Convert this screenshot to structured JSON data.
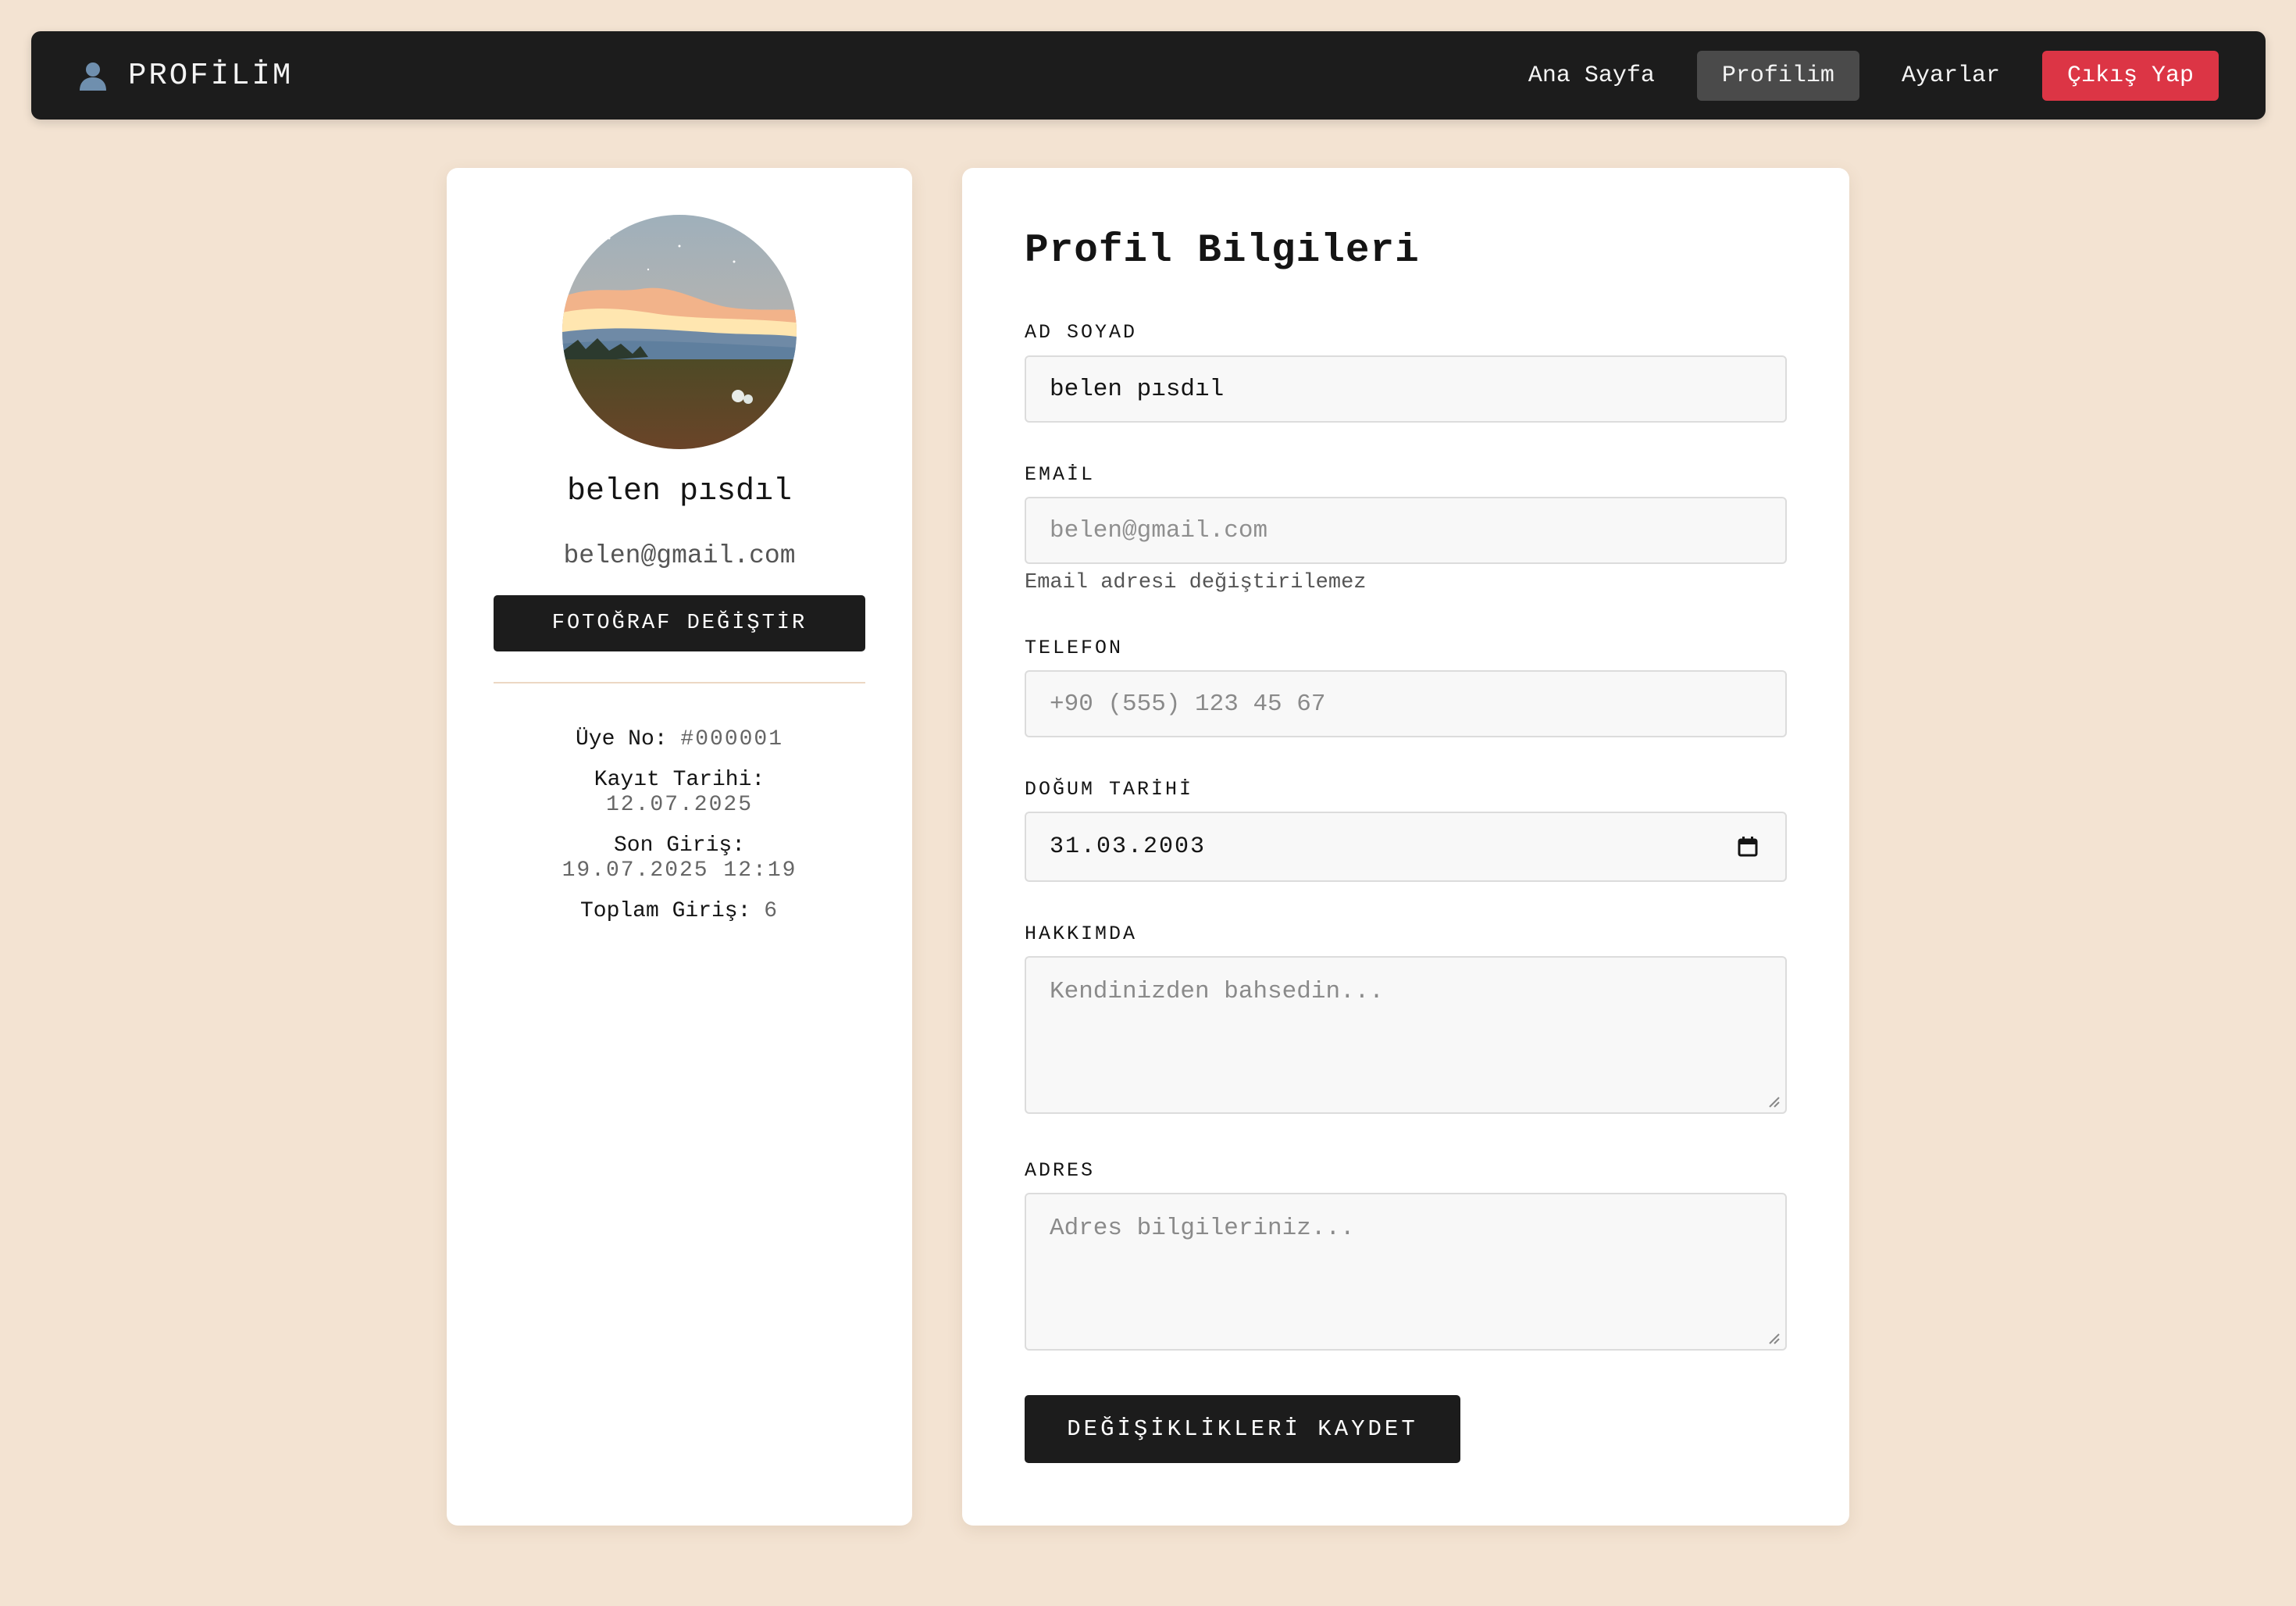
{
  "navbar": {
    "brand_icon": "user-icon",
    "brand": "PROFİLİM",
    "links": [
      "Ana Sayfa",
      "Profilim",
      "Ayarlar"
    ],
    "logout": "Çıkış Yap",
    "logout_color": "#dc3545"
  },
  "sidebar": {
    "name": "belen pısdıl",
    "email": "belen@gmail.com",
    "photo_button": "FOTOĞRAF DEĞİŞTİR",
    "stats": {
      "member_no_label": "Üye No:",
      "member_no": "#000001",
      "registered_label": "Kayıt Tarihi:",
      "registered": "12.07.2025",
      "last_login_label": "Son Giriş:",
      "last_login": "19.07.2025 12:19",
      "total_logins_label": "Toplam Giriş:",
      "total_logins": "6"
    }
  },
  "form": {
    "title": "Profil Bilgileri",
    "fullname_label": "AD SOYAD",
    "fullname_value": "belen pısdıl",
    "email_label": "EMAİL",
    "email_value": "belen@gmail.com",
    "email_help": "Email adresi değiştirilemez",
    "phone_label": "TELEFON",
    "phone_placeholder": "+90 (555) 123 45 67",
    "birthdate_label": "DOĞUM TARİHİ",
    "birthdate_value": "31.03.2003",
    "about_label": "HAKKIMDA",
    "about_placeholder": "Kendinizden bahsedin...",
    "address_label": "ADRES",
    "address_placeholder": "Adres bilgileriniz...",
    "save_button": "DEĞİŞİKLİKLERİ KAYDET"
  },
  "colors": {
    "page_bg": "#f3e3d2",
    "dark": "#1c1c1c",
    "danger": "#dc3545"
  }
}
